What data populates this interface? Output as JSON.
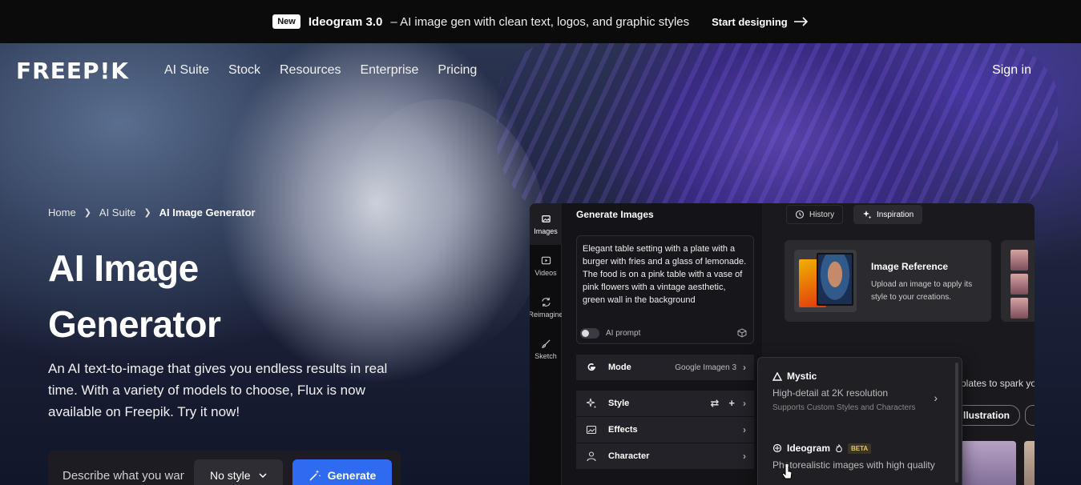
{
  "announcement": {
    "badge": "New",
    "title": "Ideogram 3.0",
    "description": "– AI image gen with clean text, logos, and graphic styles",
    "cta": "Start designing"
  },
  "nav": {
    "logo": "FREEP!K",
    "links": [
      "AI Suite",
      "Stock",
      "Resources",
      "Enterprise",
      "Pricing"
    ],
    "sign_in": "Sign in"
  },
  "breadcrumb": [
    "Home",
    "AI Suite",
    "AI Image Generator"
  ],
  "hero": {
    "title_line1": "AI Image",
    "title_line2": "Generator",
    "subtitle": "An AI text-to-image that gives you endless results in real time. With a variety of models to choose, Flux is now available on Freepik. Try it now!"
  },
  "prompt_bar": {
    "placeholder": "Describe what you want to create",
    "style_label": "No style",
    "generate_label": "Generate"
  },
  "app": {
    "sidebar": [
      {
        "label": "Images",
        "icon": "images-icon",
        "active": true
      },
      {
        "label": "Videos",
        "icon": "video-icon",
        "active": false
      },
      {
        "label": "Reimagine",
        "icon": "reimagine-icon",
        "active": false
      },
      {
        "label": "Sketch",
        "icon": "brush-icon",
        "active": false
      }
    ],
    "panel_title": "Generate Images",
    "prompt_text": "Elegant table setting with a plate with a burger with fries and a glass of lemonade. The food is on a pink table with a vase of pink flowers with a vintage aesthetic, green wall in the background",
    "ai_prompt_label": "AI prompt",
    "mode_label": "Mode",
    "mode_value": "Google Imagen 3",
    "style_label": "Style",
    "effects_label": "Effects",
    "character_label": "Character",
    "tabs": {
      "history": "History",
      "inspiration": "Inspiration"
    },
    "image_reference": {
      "title": "Image Reference",
      "description": "Upload an image to apply its style to your creations."
    },
    "spark_text": "plates to spark yo",
    "chip_label": "llustration"
  },
  "dropdown": {
    "items": [
      {
        "name": "Mystic",
        "description": "High-detail at 2K resolution",
        "sub": "Supports Custom Styles and Characters"
      },
      {
        "name": "Ideogram",
        "badge": "BETA",
        "description": "Photorealistic images with high quality"
      }
    ]
  },
  "colors": {
    "accent": "#2f6bf0",
    "announce_bg": "#0b0b0b"
  }
}
